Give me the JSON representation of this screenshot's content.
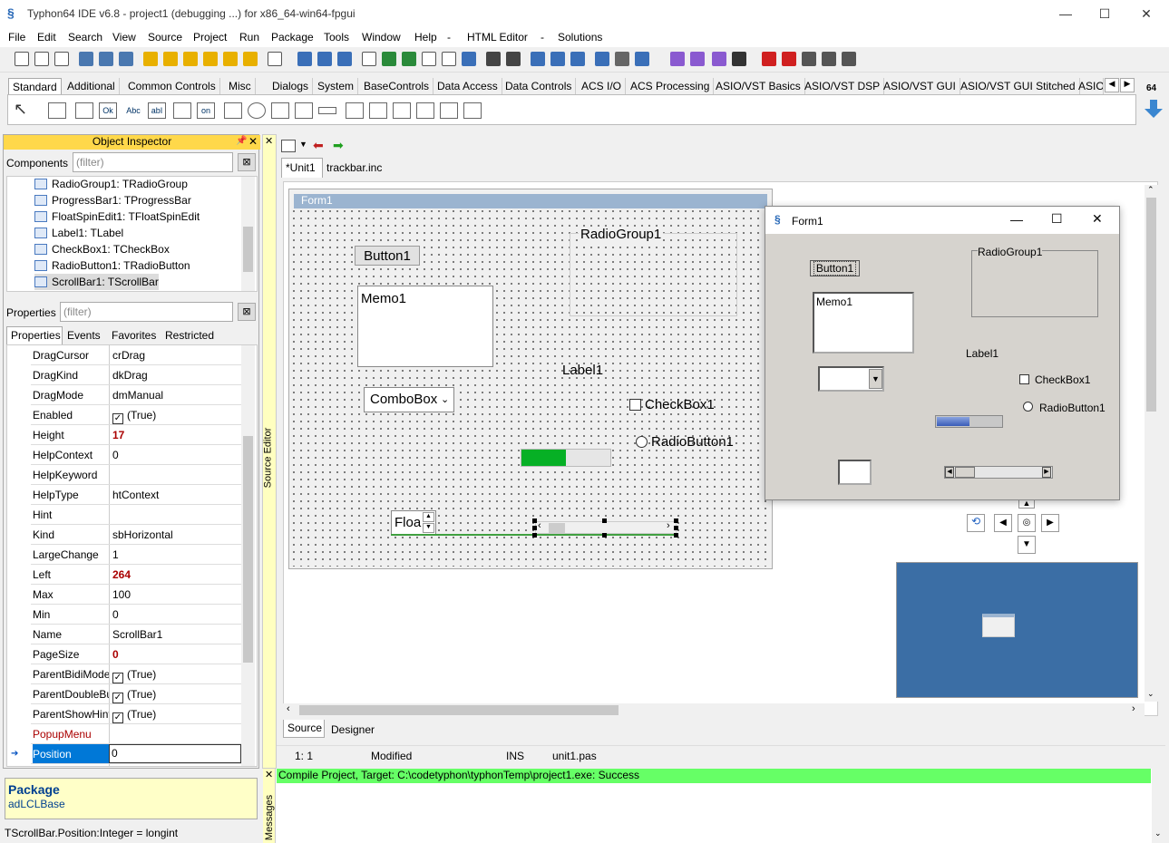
{
  "window": {
    "title": "Typhon64 IDE v6.8 - project1 (debugging ...) for x86_64-win64-fpgui",
    "minimize": "—",
    "maximize": "☐",
    "close": "✕"
  },
  "menu": [
    "File",
    "Edit",
    "Search",
    "View",
    "Source",
    "Project",
    "Run",
    "Package",
    "Tools",
    "Window",
    "Help",
    "-",
    "HTML Editor",
    "-",
    "Solutions"
  ],
  "palette": {
    "tabs": [
      "Standard",
      "Additional",
      "Common Controls",
      "Misc",
      "Dialogs",
      "System",
      "BaseControls",
      "Data Access",
      "Data Controls",
      "ACS I/O",
      "ACS Processing",
      "ASIO/VST Basics",
      "ASIO/VST DSP",
      "ASIO/VST GUI",
      "ASIO/VST GUI Stitched",
      "ASIO."
    ],
    "arch_label": "64",
    "icons": [
      "Ok",
      "Abc",
      "abI",
      "on"
    ]
  },
  "object_inspector": {
    "title": "Object Inspector",
    "components_label": "Components",
    "components_filter": "(filter)",
    "tree": [
      "RadioGroup1: TRadioGroup",
      "ProgressBar1: TProgressBar",
      "FloatSpinEdit1: TFloatSpinEdit",
      "Label1: TLabel",
      "CheckBox1: TCheckBox",
      "RadioButton1: TRadioButton",
      "ScrollBar1: TScrollBar"
    ],
    "properties_label": "Properties",
    "properties_filter": "(filter)",
    "tabs": [
      "Properties",
      "Events",
      "Favorites",
      "Restricted"
    ],
    "properties": [
      {
        "name": "DragCursor",
        "value": "crDrag"
      },
      {
        "name": "DragKind",
        "value": "dkDrag"
      },
      {
        "name": "DragMode",
        "value": "dmManual"
      },
      {
        "name": "Enabled",
        "value": "(True)"
      },
      {
        "name": "Height",
        "value": "17"
      },
      {
        "name": "HelpContext",
        "value": "0"
      },
      {
        "name": "HelpKeyword",
        "value": ""
      },
      {
        "name": "HelpType",
        "value": "htContext"
      },
      {
        "name": "Hint",
        "value": ""
      },
      {
        "name": "Kind",
        "value": "sbHorizontal"
      },
      {
        "name": "LargeChange",
        "value": "1"
      },
      {
        "name": "Left",
        "value": "264"
      },
      {
        "name": "Max",
        "value": "100"
      },
      {
        "name": "Min",
        "value": "0"
      },
      {
        "name": "Name",
        "value": "ScrollBar1"
      },
      {
        "name": "PageSize",
        "value": "0"
      },
      {
        "name": "ParentBidiMode",
        "value": "(True)"
      },
      {
        "name": "ParentDoubleBuffered",
        "value": "(True)"
      },
      {
        "name": "ParentShowHint",
        "value": "(True)"
      },
      {
        "name": "PopupMenu",
        "value": ""
      },
      {
        "name": "Position",
        "value": "0"
      }
    ],
    "package_label": "Package",
    "package_value": "adLCLBase",
    "status": "TScrollBar.Position:Integer = longint"
  },
  "editor": {
    "tabs": [
      "*Unit1",
      "trackbar.inc"
    ],
    "side_label": "Source Editor",
    "bottom_tabs": [
      "Source",
      "Designer"
    ],
    "status": {
      "pos": "1:  1",
      "state": "Modified",
      "mode": "INS",
      "file": "unit1.pas"
    }
  },
  "designer": {
    "form_caption": "Form1",
    "button": "Button1",
    "radiogroup": "RadioGroup1",
    "memo": "Memo1",
    "label": "Label1",
    "combobox": "ComboBox",
    "checkbox": "CheckBox1",
    "radiobutton": "RadioButton1",
    "floatspin": "Floa",
    "progress_fraction": 0.5
  },
  "runtime_form": {
    "title": "Form1",
    "button": "Button1",
    "radiogroup": "RadioGroup1",
    "memo": "Memo1",
    "label": "Label1",
    "checkbox": "CheckBox1",
    "radiobutton": "RadioButton1",
    "progress_fraction": 0.5
  },
  "messages": {
    "side_label": "Messages",
    "text": "Compile Project, Target: C:\\codetyphon\\typhonTemp\\project1.exe: Success",
    "color": "#66ff66"
  }
}
